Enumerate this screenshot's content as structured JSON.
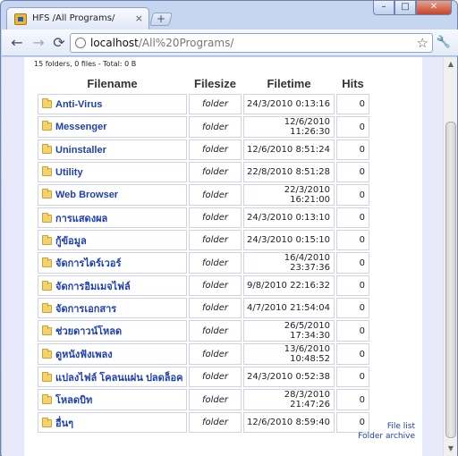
{
  "tab": {
    "title": "HFS /All Programs/",
    "close": "×",
    "new_tab": "+"
  },
  "window": {
    "minimize": "–",
    "maximize": "□",
    "close": "✕"
  },
  "toolbar": {
    "back": "←",
    "forward": "→",
    "reload": "⟳",
    "url_host": "localhost",
    "url_path": "/All%20Programs/",
    "star": "☆",
    "wrench": "🔧"
  },
  "page": {
    "summary": "15 folders, 0 files - Total: 0 B",
    "headers": {
      "name": "Filename",
      "size": "Filesize",
      "time": "Filetime",
      "hits": "Hits"
    },
    "rows": [
      {
        "name": "Anti-Virus",
        "size": "folder",
        "time": "24/3/2010 0:13:16",
        "hits": "0"
      },
      {
        "name": "Messenger",
        "size": "folder",
        "time": "12/6/2010 11:26:30",
        "hits": "0"
      },
      {
        "name": "Uninstaller",
        "size": "folder",
        "time": "12/6/2010 8:51:24",
        "hits": "0"
      },
      {
        "name": "Utility",
        "size": "folder",
        "time": "22/8/2010 8:51:28",
        "hits": "0"
      },
      {
        "name": "Web Browser",
        "size": "folder",
        "time": "22/3/2010 16:21:00",
        "hits": "0"
      },
      {
        "name": "การแสดงผล",
        "size": "folder",
        "time": "24/3/2010 0:13:10",
        "hits": "0"
      },
      {
        "name": "กู้ข้อมูล",
        "size": "folder",
        "time": "24/3/2010 0:15:10",
        "hits": "0"
      },
      {
        "name": "จัดการไดร์เวอร์",
        "size": "folder",
        "time": "16/4/2010 23:37:36",
        "hits": "0"
      },
      {
        "name": "จัดการอิมเมจไฟล์",
        "size": "folder",
        "time": "9/8/2010 22:16:32",
        "hits": "0"
      },
      {
        "name": "จัดการเอกสาร",
        "size": "folder",
        "time": "4/7/2010 21:54:04",
        "hits": "0"
      },
      {
        "name": "ช่วยดาวน์โหลด",
        "size": "folder",
        "time": "26/5/2010 17:34:30",
        "hits": "0"
      },
      {
        "name": "ดูหนังฟังเพลง",
        "size": "folder",
        "time": "13/6/2010 10:48:52",
        "hits": "0"
      },
      {
        "name": "แปลงไฟล์ โคลนแผ่น ปลดล็อค",
        "size": "folder",
        "time": "24/3/2010 0:52:38",
        "hits": "0"
      },
      {
        "name": "โหลดบิท",
        "size": "folder",
        "time": "28/3/2010 21:47:26",
        "hits": "0"
      },
      {
        "name": "อื่นๆ",
        "size": "folder",
        "time": "12/6/2010 8:59:40",
        "hits": "0"
      }
    ],
    "links": {
      "file_list": "File list",
      "folder_archive": "Folder archive"
    }
  },
  "scrollbar": {
    "up": "▲",
    "down": "▼"
  }
}
